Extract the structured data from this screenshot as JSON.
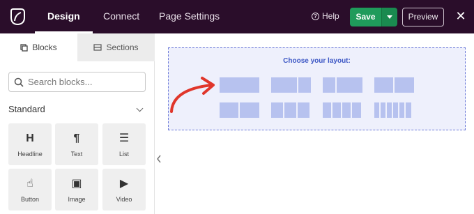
{
  "header": {
    "tabs": [
      {
        "label": "Design",
        "active": true
      },
      {
        "label": "Connect",
        "active": false
      },
      {
        "label": "Page Settings",
        "active": false
      }
    ],
    "help_label": "Help",
    "save_label": "Save",
    "preview_label": "Preview",
    "close_glyph": "✕",
    "background_color": "#2a0d2a",
    "save_color": "#1f9b5b"
  },
  "sidebar": {
    "tabs": [
      {
        "label": "Blocks",
        "icon": "blocks-icon",
        "active": true
      },
      {
        "label": "Sections",
        "icon": "sections-icon",
        "active": false
      }
    ],
    "search": {
      "placeholder": "Search blocks...",
      "value": ""
    },
    "section_title": "Standard",
    "blocks": [
      {
        "label": "Headline",
        "icon": "H"
      },
      {
        "label": "Text",
        "icon": "¶"
      },
      {
        "label": "List",
        "icon": "☰"
      },
      {
        "label": "Button",
        "icon": "☝"
      },
      {
        "label": "Image",
        "icon": "▣"
      },
      {
        "label": "Video",
        "icon": "▶"
      }
    ]
  },
  "canvas": {
    "layout_prompt": "Choose your layout:",
    "layout_options": [
      {
        "name": "1 column",
        "columns": 1
      },
      {
        "name": "2 columns narrow-wide",
        "columns": 2
      },
      {
        "name": "2 columns wide-narrow",
        "columns": 2
      },
      {
        "name": "2 columns equal",
        "columns": 2
      },
      {
        "name": "2 columns equal",
        "columns": 2
      },
      {
        "name": "3 columns",
        "columns": 3
      },
      {
        "name": "4 columns",
        "columns": 4
      },
      {
        "name": "6 columns",
        "columns": 6
      }
    ],
    "accent_color": "#3a55c4",
    "arrow_color": "#e0362b"
  }
}
